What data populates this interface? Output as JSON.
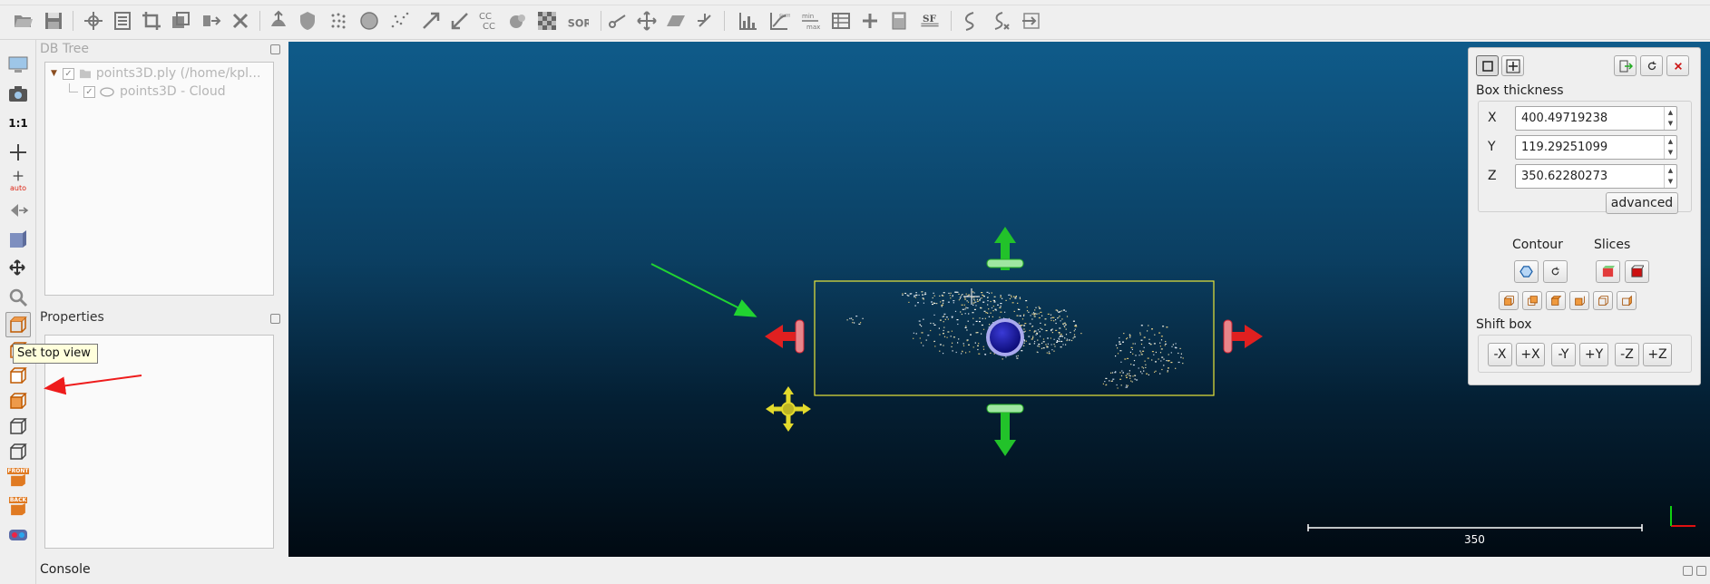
{
  "toolbar_icons": [
    "open-icon",
    "save-icon",
    "transform-icon",
    "list-icon",
    "crop-icon",
    "clone-icon",
    "merge-icon",
    "delete-icon",
    "normals-icon",
    "shield-icon",
    "subsample-icon",
    "sphere-icon",
    "scatter-icon",
    "arrow-icon",
    "resize-icon",
    "cc-icon",
    "ball-icon",
    "checker-icon",
    "sor-icon",
    "cut-icon",
    "move-icon",
    "plane-icon",
    "crosshair-icon",
    "histogram-icon",
    "plot-icon",
    "minmax-icon",
    "table-icon",
    "plus-icon",
    "calculator-icon",
    "sf-icon",
    "curve-icon",
    "register-icon",
    "swap-icon"
  ],
  "toolbar_texts": {
    "cc": "CC\nCC",
    "sor": "SOR",
    "sf": "SF",
    "minmax_top": "min",
    "minmax_bottom": "max",
    "plot_top": "sum"
  },
  "left_toolbar": {
    "icons": [
      "display-icon",
      "camera-icon",
      "one-to-one-icon",
      "pivot-icon",
      "pivot-auto-icon",
      "viewpoint-icon",
      "perspective-icon",
      "rotation-icon",
      "zoom-icon",
      "top-view-icon",
      "bottom-view-icon",
      "front-view-icon",
      "back-view-icon",
      "left-view-icon",
      "right-view-icon",
      "iso-front-icon",
      "iso-back-icon",
      "stereo-icon"
    ],
    "labels": {
      "one_to_one": "1:1",
      "auto": "auto",
      "front": "FRONT",
      "back": "BACK"
    }
  },
  "db_tree": {
    "title": "DB Tree",
    "items": [
      {
        "label": "points3D.ply (/home/kpl...",
        "checked": true
      },
      {
        "label": "points3D - Cloud",
        "checked": true
      }
    ]
  },
  "properties": {
    "title": "Properties"
  },
  "tooltip": "Set top view",
  "console": {
    "title": "Console"
  },
  "scale_bar": {
    "label": "350"
  },
  "section_panel": {
    "box_thickness_label": "Box thickness",
    "x_label": "X",
    "x_value": "400.49719238",
    "y_label": "Y",
    "y_value": "119.29251099",
    "z_label": "Z",
    "z_value": "350.62280273",
    "advanced_label": "advanced",
    "contour_label": "Contour",
    "slices_label": "Slices",
    "shift_box_label": "Shift box",
    "shift_buttons": [
      "-X",
      "+X",
      "-Y",
      "+Y",
      "-Z",
      "+Z"
    ]
  },
  "colors": {
    "viewport_top": "#0f5b8a",
    "viewport_bottom": "#010a12",
    "box_outline": "#e8e63a",
    "arrow_red": "#e02020",
    "arrow_green": "#22c22a",
    "arrow_yellow": "#e3da2c",
    "sphere_blue": "#1a1aa8",
    "annotation_green": "#21d331",
    "annotation_red": "#ee1c1c"
  }
}
